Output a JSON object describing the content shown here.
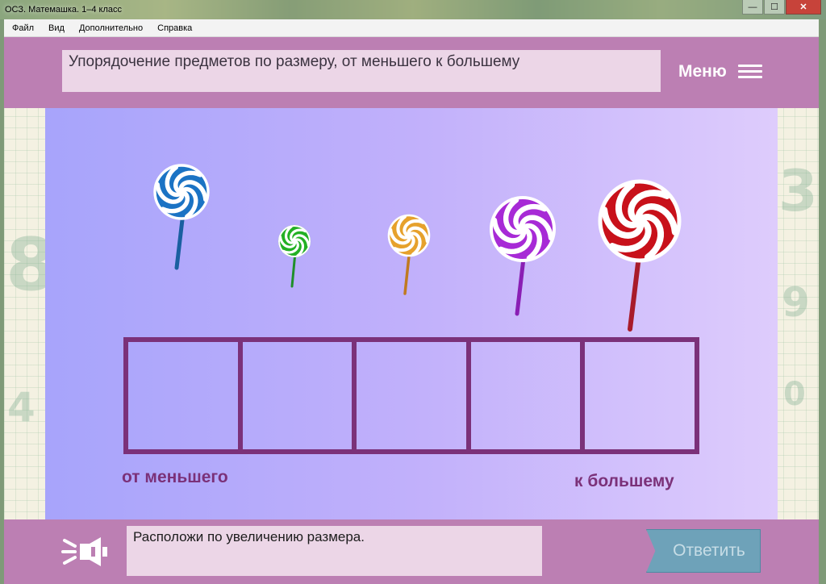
{
  "window": {
    "title": "ОСЗ. Матемашка. 1–4 класс",
    "minimize_glyph": "—",
    "maximize_glyph": "☐",
    "close_glyph": "✕"
  },
  "menubar": {
    "items": [
      "Файл",
      "Вид",
      "Дополнительно",
      "Справка"
    ]
  },
  "header": {
    "task_text": "Упорядочение предметов по размеру, от меньшего к большему",
    "menu_label": "Меню",
    "menu_icon": "hamburger-icon"
  },
  "play_area": {
    "background_colors": [
      "#a7a4fb",
      "#deccfc"
    ],
    "lollipops": [
      {
        "color": "blue",
        "hex": "#1b73c4",
        "stick_hex": "#1a5fa0",
        "icon": "lollipop-icon"
      },
      {
        "color": "green",
        "hex": "#23b024",
        "stick_hex": "#1f8f2a",
        "icon": "lollipop-icon"
      },
      {
        "color": "orange",
        "hex": "#e6a12c",
        "stick_hex": "#c07a20",
        "icon": "lollipop-icon"
      },
      {
        "color": "purple",
        "hex": "#a72ad6",
        "stick_hex": "#8a1fb4",
        "icon": "lollipop-icon"
      },
      {
        "color": "red",
        "hex": "#c8111a",
        "stick_hex": "#a81b2a",
        "icon": "lollipop-icon"
      }
    ],
    "slot_count": 5,
    "slot_border_color": "#7b3179",
    "caption_left": "от меньшего",
    "caption_right": "к большему"
  },
  "footer": {
    "speaker_icon": "speaker-icon",
    "hint_text": "Расположи по увеличению размера.",
    "answer_label": "Ответить"
  },
  "colors": {
    "panel": "#bc7fb3",
    "text_box": "#ecd6e7",
    "answer_button": "#6ea2b9"
  }
}
